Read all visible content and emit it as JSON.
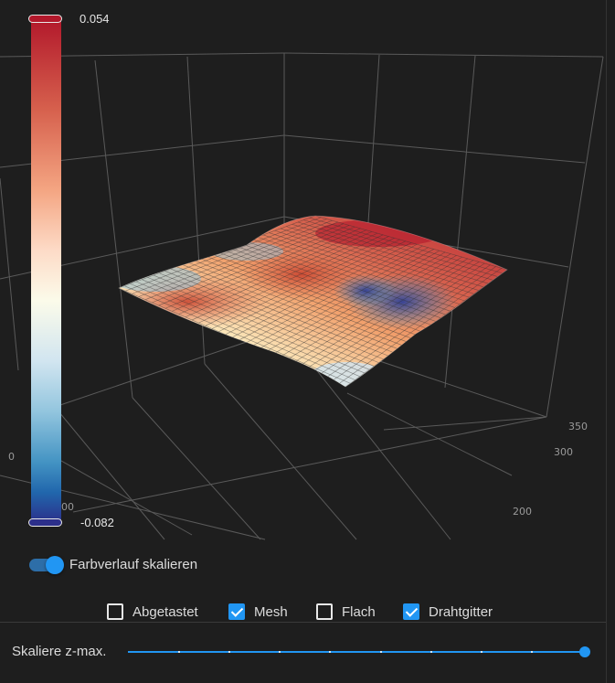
{
  "colorbar": {
    "max_label": "0.054",
    "min_label": "-0.082"
  },
  "axes": {
    "y_ticks": [
      "350",
      "300",
      "200"
    ],
    "x_tick_partial": "00",
    "z_tick_partial": "0"
  },
  "toggle": {
    "label": "Farbverlauf skalieren",
    "on": true
  },
  "checkboxes": [
    {
      "label": "Abgetastet",
      "checked": false
    },
    {
      "label": "Mesh",
      "checked": true
    },
    {
      "label": "Flach",
      "checked": false
    },
    {
      "label": "Drahtgitter",
      "checked": true
    }
  ],
  "zmax_slider": {
    "label": "Skaliere z-max.",
    "value": 1.0
  },
  "colors": {
    "accent": "#2196f3",
    "background": "#1e1e1e"
  }
}
